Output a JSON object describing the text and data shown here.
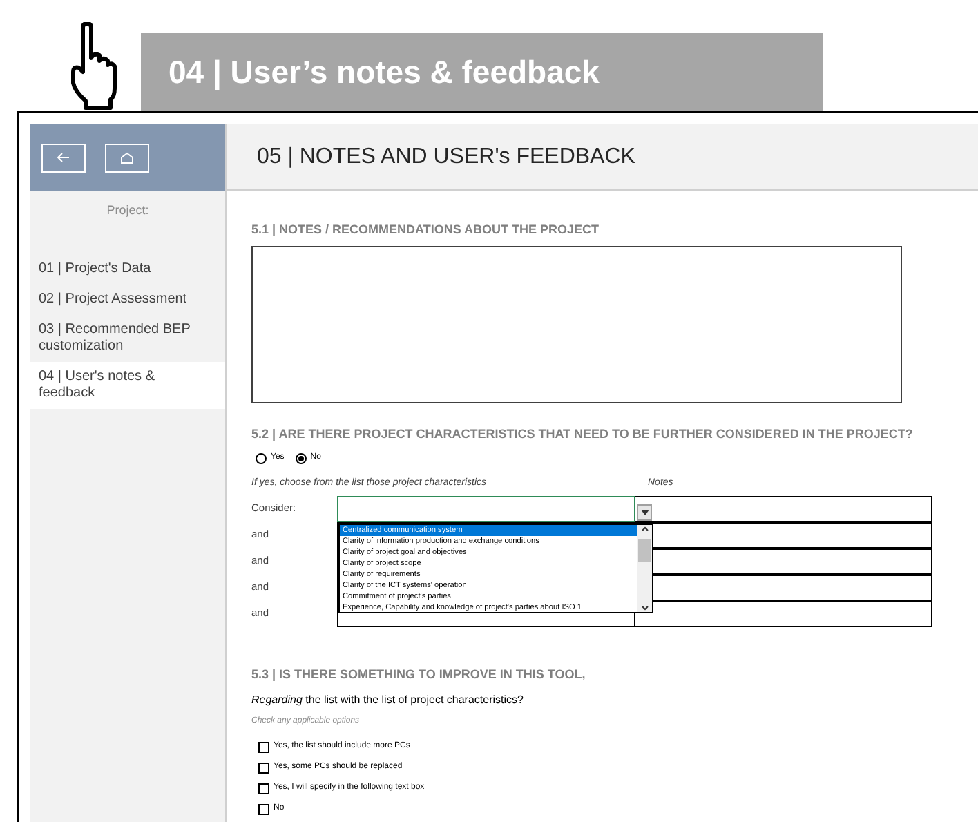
{
  "banner": {
    "title": "04 | User’s notes & feedback"
  },
  "sidebar": {
    "label": "Project:",
    "items": [
      {
        "label": "01 | Project's Data",
        "selected": false
      },
      {
        "label": "02 | Project Assessment",
        "selected": false
      },
      {
        "label": "03 | Recommended BEP customization",
        "selected": false
      },
      {
        "label": "04 | User's notes & feedback",
        "selected": true
      }
    ]
  },
  "header": {
    "title": "05 | NOTES AND USER's FEEDBACK"
  },
  "section_1": {
    "heading": "5.1 | NOTES / RECOMMENDATIONS ABOUT THE PROJECT"
  },
  "section_2": {
    "heading": "5.2 | ARE THERE PROJECT CHARACTERISTICS THAT NEED TO BE FURTHER CONSIDERED IN THE PROJECT?",
    "options": [
      {
        "label": "Yes",
        "selected": false
      },
      {
        "label": "No",
        "selected": true
      }
    ],
    "choose_label": "If yes, choose from the list those project characteristics",
    "notes_label": "Notes",
    "rows": [
      "Consider:",
      "and",
      "and",
      "and",
      "and"
    ],
    "dropdown": [
      {
        "label": "Centralized communication system",
        "selected": true
      },
      {
        "label": "Clarity of information production and exchange conditions",
        "selected": false
      },
      {
        "label": "Clarity of project goal and objectives",
        "selected": false
      },
      {
        "label": "Clarity of project scope",
        "selected": false
      },
      {
        "label": "Clarity of requirements",
        "selected": false
      },
      {
        "label": "Clarity of the ICT systems' operation",
        "selected": false
      },
      {
        "label": "Commitment of project's parties",
        "selected": false
      },
      {
        "label": "Experience, Capability and knowledge of project's parties about ISO 1",
        "selected": false
      }
    ]
  },
  "section_3": {
    "heading": "5.3 | IS THERE SOMETHING TO IMPROVE IN THIS TOOL,",
    "question": "*Regarding* the list with the list of project characteristics?",
    "hint": "Check any applicable options",
    "options": [
      {
        "label": "Yes, the list should include more PCs",
        "checked": false
      },
      {
        "label": "Yes, some PCs should be replaced",
        "checked": false
      },
      {
        "label": "Yes, I will specify in the following text box",
        "checked": false
      },
      {
        "label": "No",
        "checked": false
      }
    ]
  }
}
